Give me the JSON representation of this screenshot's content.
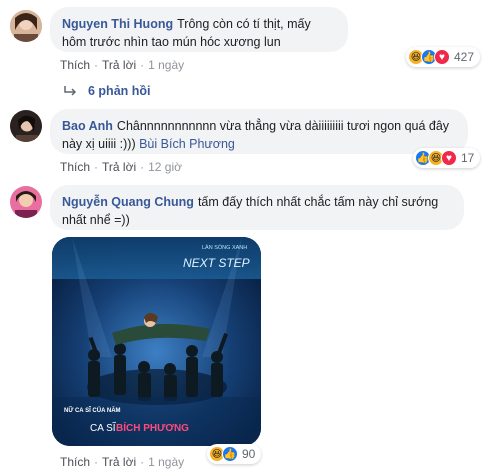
{
  "comments": [
    {
      "author": "Nguyen Thi Huong",
      "text": "Trông còn có tí thịt, mấy hôm trước nhìn tao mún hóc xương lun",
      "like_label": "Thích",
      "reply_label": "Trả lời",
      "time": "1 ngày",
      "reaction_count": "427",
      "reactions": [
        "haha-icon",
        "like-icon",
        "love-icon"
      ]
    },
    {
      "author": "Bao Anh",
      "text": "Chânnnnnnnnnnn vừa thẳng vừa dàiiiiiiiii tươi ngon quá đây này xị uiiii :))) ",
      "mention": "Bùi Bích Phương",
      "like_label": "Thích",
      "reply_label": "Trả lời",
      "time": "12 giờ",
      "reaction_count": "17",
      "reactions": [
        "like-icon",
        "haha-icon",
        "love-icon"
      ]
    },
    {
      "author": "Nguyễn Quang Chung",
      "text": "tấm đấy thích nhất chắc tấm này chỉ sướng nhất nhể =))",
      "like_label": "Thích",
      "reply_label": "Trả lời",
      "time": "1 ngày",
      "reaction_count": "90",
      "reactions": [
        "haha-icon",
        "like-icon"
      ]
    }
  ],
  "replies_label": "6 phản hồi",
  "photo": {
    "logo_top": "LÀN SÓNG XANH",
    "logo_main": "NEXT STEP",
    "caption_small": "NỮ CA SĨ CỦA NĂM",
    "caption_prefix": "CA SĨ",
    "caption_name": "BÍCH PHƯƠNG"
  },
  "colors": {
    "link": "#385898",
    "bubble": "#f2f3f5",
    "like": "#1877f2",
    "love": "#f0284a",
    "haha": "#f7b125"
  }
}
